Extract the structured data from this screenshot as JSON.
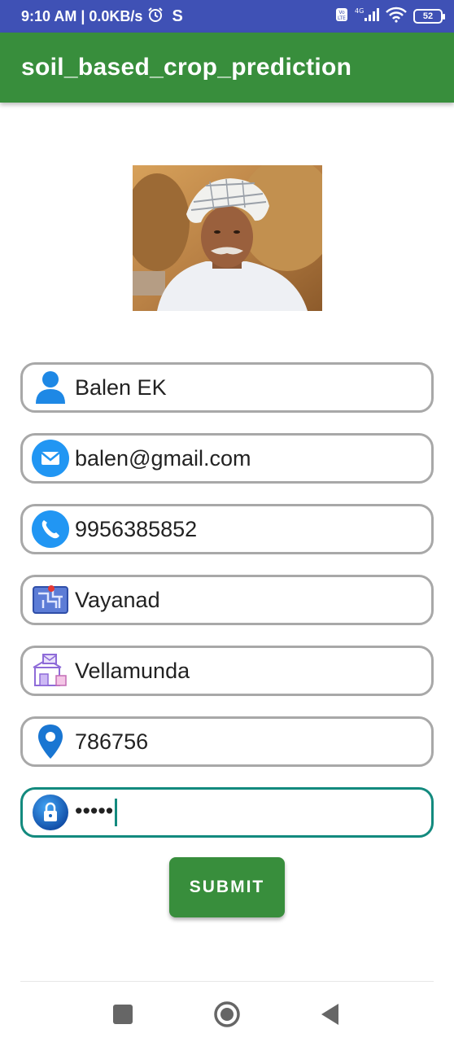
{
  "status_bar": {
    "time_network": "9:10 AM | 0.0KB/s",
    "s_indicator": "S",
    "battery": "52",
    "icons": [
      "alarm-icon",
      "volte-icon",
      "4g-signal-icon",
      "wifi-icon",
      "battery-icon"
    ]
  },
  "app_bar": {
    "title": "soil_based_crop_prediction"
  },
  "profile_image": {
    "description_icon": "farmer-photo"
  },
  "form": {
    "name": {
      "value": "Balen EK",
      "icon": "person-icon"
    },
    "email": {
      "value": "balen@gmail.com",
      "icon": "email-icon"
    },
    "phone": {
      "value": "9956385852",
      "icon": "phone-icon"
    },
    "district": {
      "value": "Vayanad",
      "icon": "map-icon"
    },
    "place": {
      "value": "Vellamunda",
      "icon": "post-office-icon"
    },
    "pincode": {
      "value": "786756",
      "icon": "location-pin-icon"
    },
    "password": {
      "value": "•••••",
      "icon": "lock-icon"
    }
  },
  "submit": {
    "label": "SUBMIT"
  },
  "colors": {
    "status_bar": "#3f51b5",
    "app_bar": "#388e3c",
    "button": "#388e3c",
    "focused_border": "#138a7e",
    "field_border": "#a8a8a8"
  },
  "nav": {
    "icons": [
      "recents-square-icon",
      "home-circle-icon",
      "back-triangle-icon"
    ]
  }
}
